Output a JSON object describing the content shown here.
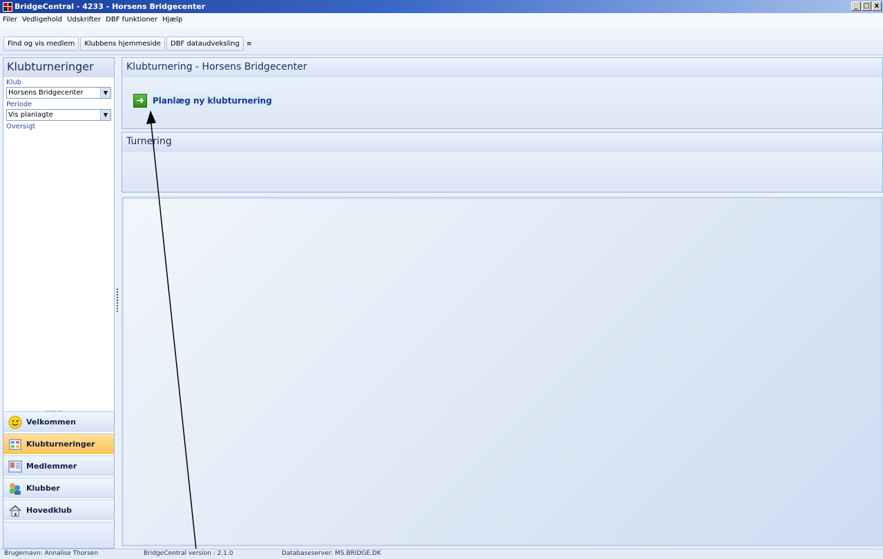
{
  "window": {
    "title": "BridgeCentral - 4233 - Horsens Bridgecenter",
    "min": "_",
    "max": "□",
    "close": "x"
  },
  "menu": [
    "Filer",
    "Vedligehold",
    "Udskrifter",
    "DBF funktioner",
    "Hjælp"
  ],
  "toolbar": {
    "find_member": "Find og vis medlem",
    "club_homepage": "Klubbens hjemmeside",
    "dbf_exchange": "DBF dataudveksling",
    "overflow": "≡"
  },
  "sidebar": {
    "title": "Klubturneringer",
    "club_label": "Klub",
    "club_value": "Horsens Bridgecenter",
    "period_label": "Periode",
    "period_value": "Vis planlagte",
    "overview_label": "Oversigt",
    "grip": "………"
  },
  "nav": [
    {
      "label": "Velkommen",
      "icon": "smiley-icon"
    },
    {
      "label": "Klubturneringer",
      "icon": "tournament-icon"
    },
    {
      "label": "Medlemmer",
      "icon": "members-icon"
    },
    {
      "label": "Klubber",
      "icon": "clubs-icon"
    },
    {
      "label": "Hovedklub",
      "icon": "house-icon"
    }
  ],
  "panel_top": {
    "title": "Klubturnering - Horsens Bridgecenter",
    "action": "Planlæg ny klubturnering"
  },
  "panel_tournament": {
    "title": "Turnering"
  },
  "status": {
    "user": "Brugernavn: Annalise Thorsen",
    "version": "BridgeCentral version : 2.1.0",
    "db": "Databaseserver: MS.BRIDGE.DK"
  },
  "colors": {
    "accent": "#2f8a1d",
    "active_nav": "#ffc25a",
    "title_bar": "#1a3e9c"
  }
}
